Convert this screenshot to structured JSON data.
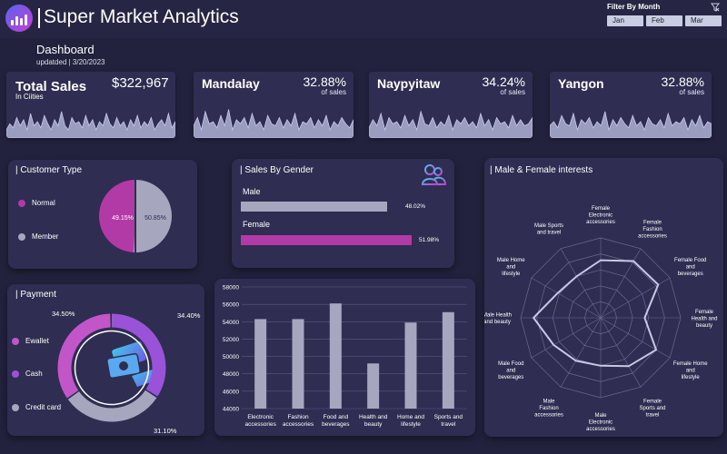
{
  "header": {
    "title": "Super Market Analytics",
    "filter_label": "Filter By Month",
    "months": [
      "Jan",
      "Feb",
      "Mar"
    ]
  },
  "dashboard": {
    "title": "Dashboard",
    "updated": "updatded | 3/20/2023"
  },
  "kpis": {
    "total": {
      "name": "Total Sales",
      "sub": "In Ciities",
      "value": "$322,967"
    },
    "cities": [
      {
        "name": "Mandalay",
        "pct": "32.88%",
        "sub": "of sales"
      },
      {
        "name": "Naypyitaw",
        "pct": "34.24%",
        "sub": "of sales"
      },
      {
        "name": "Yangon",
        "pct": "32.88%",
        "sub": "of sales"
      }
    ]
  },
  "customer_type": {
    "title": "Customer Type",
    "items": [
      {
        "label": "Normal",
        "color": "#b23aa6"
      },
      {
        "label": "Member",
        "color": "#a6a6be"
      }
    ],
    "pct_labels": [
      "49.15%",
      "50.85%"
    ]
  },
  "gender": {
    "title": "Sales By Gender",
    "items": [
      {
        "label": "Male",
        "pct": "48.02%",
        "color": "#a6a6be"
      },
      {
        "label": "Female",
        "pct": "51.98%",
        "color": "#b23aa6"
      }
    ]
  },
  "payment": {
    "title": "Payment",
    "items": [
      {
        "label": "Ewallet",
        "color": "#c255c8"
      },
      {
        "label": "Cash",
        "color": "#9a52d8"
      },
      {
        "label": "Credit card",
        "color": "#a6a6be"
      }
    ],
    "pct_labels": [
      "34.50%",
      "34.40%",
      "31.10%"
    ]
  },
  "radar": {
    "title": "Male & Female interests"
  },
  "colors": {
    "magenta": "#b23aa6",
    "grey": "#a6a6be",
    "purple": "#9a52d8",
    "card": "#2f2d52",
    "bg": "#23223e"
  },
  "icons": [
    "chart-logo-icon",
    "filter-clear-icon",
    "users-icon",
    "money-cards-icon"
  ],
  "chart_data": [
    {
      "type": "pie",
      "labels": [
        "Normal",
        "Member"
      ],
      "values": [
        49.15,
        50.85
      ]
    },
    {
      "type": "bar",
      "orientation": "horizontal",
      "categories": [
        "Male",
        "Female"
      ],
      "values": [
        48.02,
        51.98
      ]
    },
    {
      "type": "pie",
      "style": "donut",
      "labels": [
        "Ewallet",
        "Cash",
        "Credit card"
      ],
      "values": [
        34.5,
        34.4,
        31.1
      ]
    },
    {
      "type": "bar",
      "categories": [
        "Electronic accessories",
        "Fashion accessories",
        "Food and beverages",
        "Health and beauty",
        "Home and lifestyle",
        "Sports and travel"
      ],
      "values": [
        54300,
        54300,
        56100,
        49200,
        53900,
        55100
      ],
      "yticks": [
        "58000",
        "56000",
        "54000",
        "52000",
        "50000",
        "48000",
        "46000",
        "44000"
      ],
      "ylim": [
        44000,
        58000
      ],
      "grid": true
    },
    {
      "type": "radar",
      "axes": [
        "Female Electronic accessories",
        "Female Fashion accessories",
        "Female Food and beverages",
        "Female Health and beauty",
        "Female Home and lifestyle",
        "Female Sports and travel",
        "Male Electronic accessories",
        "Male Fashion accessories",
        "Male Food and beverages",
        "Male Health and beauty",
        "Male Home and lifestyle",
        "Male Sports and travel"
      ],
      "values": [
        0.72,
        0.82,
        0.83,
        0.55,
        0.8,
        0.7,
        0.6,
        0.62,
        0.68,
        0.84,
        0.62,
        0.6
      ]
    }
  ],
  "sparklines": {
    "total": [
      0.2,
      0.35,
      0.25,
      0.5,
      0.3,
      0.45,
      0.2,
      0.6,
      0.3,
      0.4,
      0.25,
      0.55,
      0.35,
      0.2,
      0.45,
      0.3,
      0.65,
      0.3,
      0.2,
      0.5,
      0.35,
      0.4,
      0.25,
      0.55,
      0.3,
      0.45,
      0.2,
      0.4,
      0.3,
      0.6,
      0.35,
      0.25,
      0.5,
      0.3,
      0.4,
      0.2,
      0.45,
      0.3,
      0.55,
      0.25,
      0.4,
      0.3,
      0.5,
      0.2,
      0.35,
      0.45,
      0.3,
      0.6,
      0.25,
      0.4
    ],
    "mandalay": [
      0.3,
      0.5,
      0.2,
      0.65,
      0.35,
      0.4,
      0.25,
      0.55,
      0.3,
      0.7,
      0.2,
      0.45,
      0.35,
      0.5,
      0.25,
      0.6,
      0.3,
      0.4,
      0.2,
      0.55,
      0.35,
      0.3,
      0.5,
      0.25,
      0.45,
      0.3,
      0.6,
      0.2,
      0.4,
      0.35,
      0.5,
      0.25,
      0.45,
      0.3,
      0.55,
      0.2,
      0.4,
      0.3,
      0.5,
      0.35,
      0.25,
      0.45
    ],
    "naypyitaw": [
      0.25,
      0.45,
      0.3,
      0.6,
      0.2,
      0.5,
      0.35,
      0.4,
      0.25,
      0.55,
      0.3,
      0.45,
      0.2,
      0.65,
      0.35,
      0.3,
      0.5,
      0.25,
      0.4,
      0.3,
      0.55,
      0.2,
      0.45,
      0.35,
      0.5,
      0.3,
      0.4,
      0.25,
      0.6,
      0.3,
      0.45,
      0.2,
      0.5,
      0.35,
      0.4,
      0.25,
      0.55,
      0.3,
      0.45,
      0.3,
      0.35,
      0.5
    ],
    "yangon": [
      0.3,
      0.4,
      0.25,
      0.55,
      0.35,
      0.3,
      0.6,
      0.2,
      0.45,
      0.35,
      0.5,
      0.25,
      0.4,
      0.3,
      0.65,
      0.2,
      0.45,
      0.3,
      0.5,
      0.35,
      0.25,
      0.55,
      0.3,
      0.4,
      0.2,
      0.5,
      0.35,
      0.3,
      0.45,
      0.25,
      0.6,
      0.3,
      0.4,
      0.35,
      0.5,
      0.2,
      0.45,
      0.3,
      0.55,
      0.25,
      0.4,
      0.35
    ]
  }
}
